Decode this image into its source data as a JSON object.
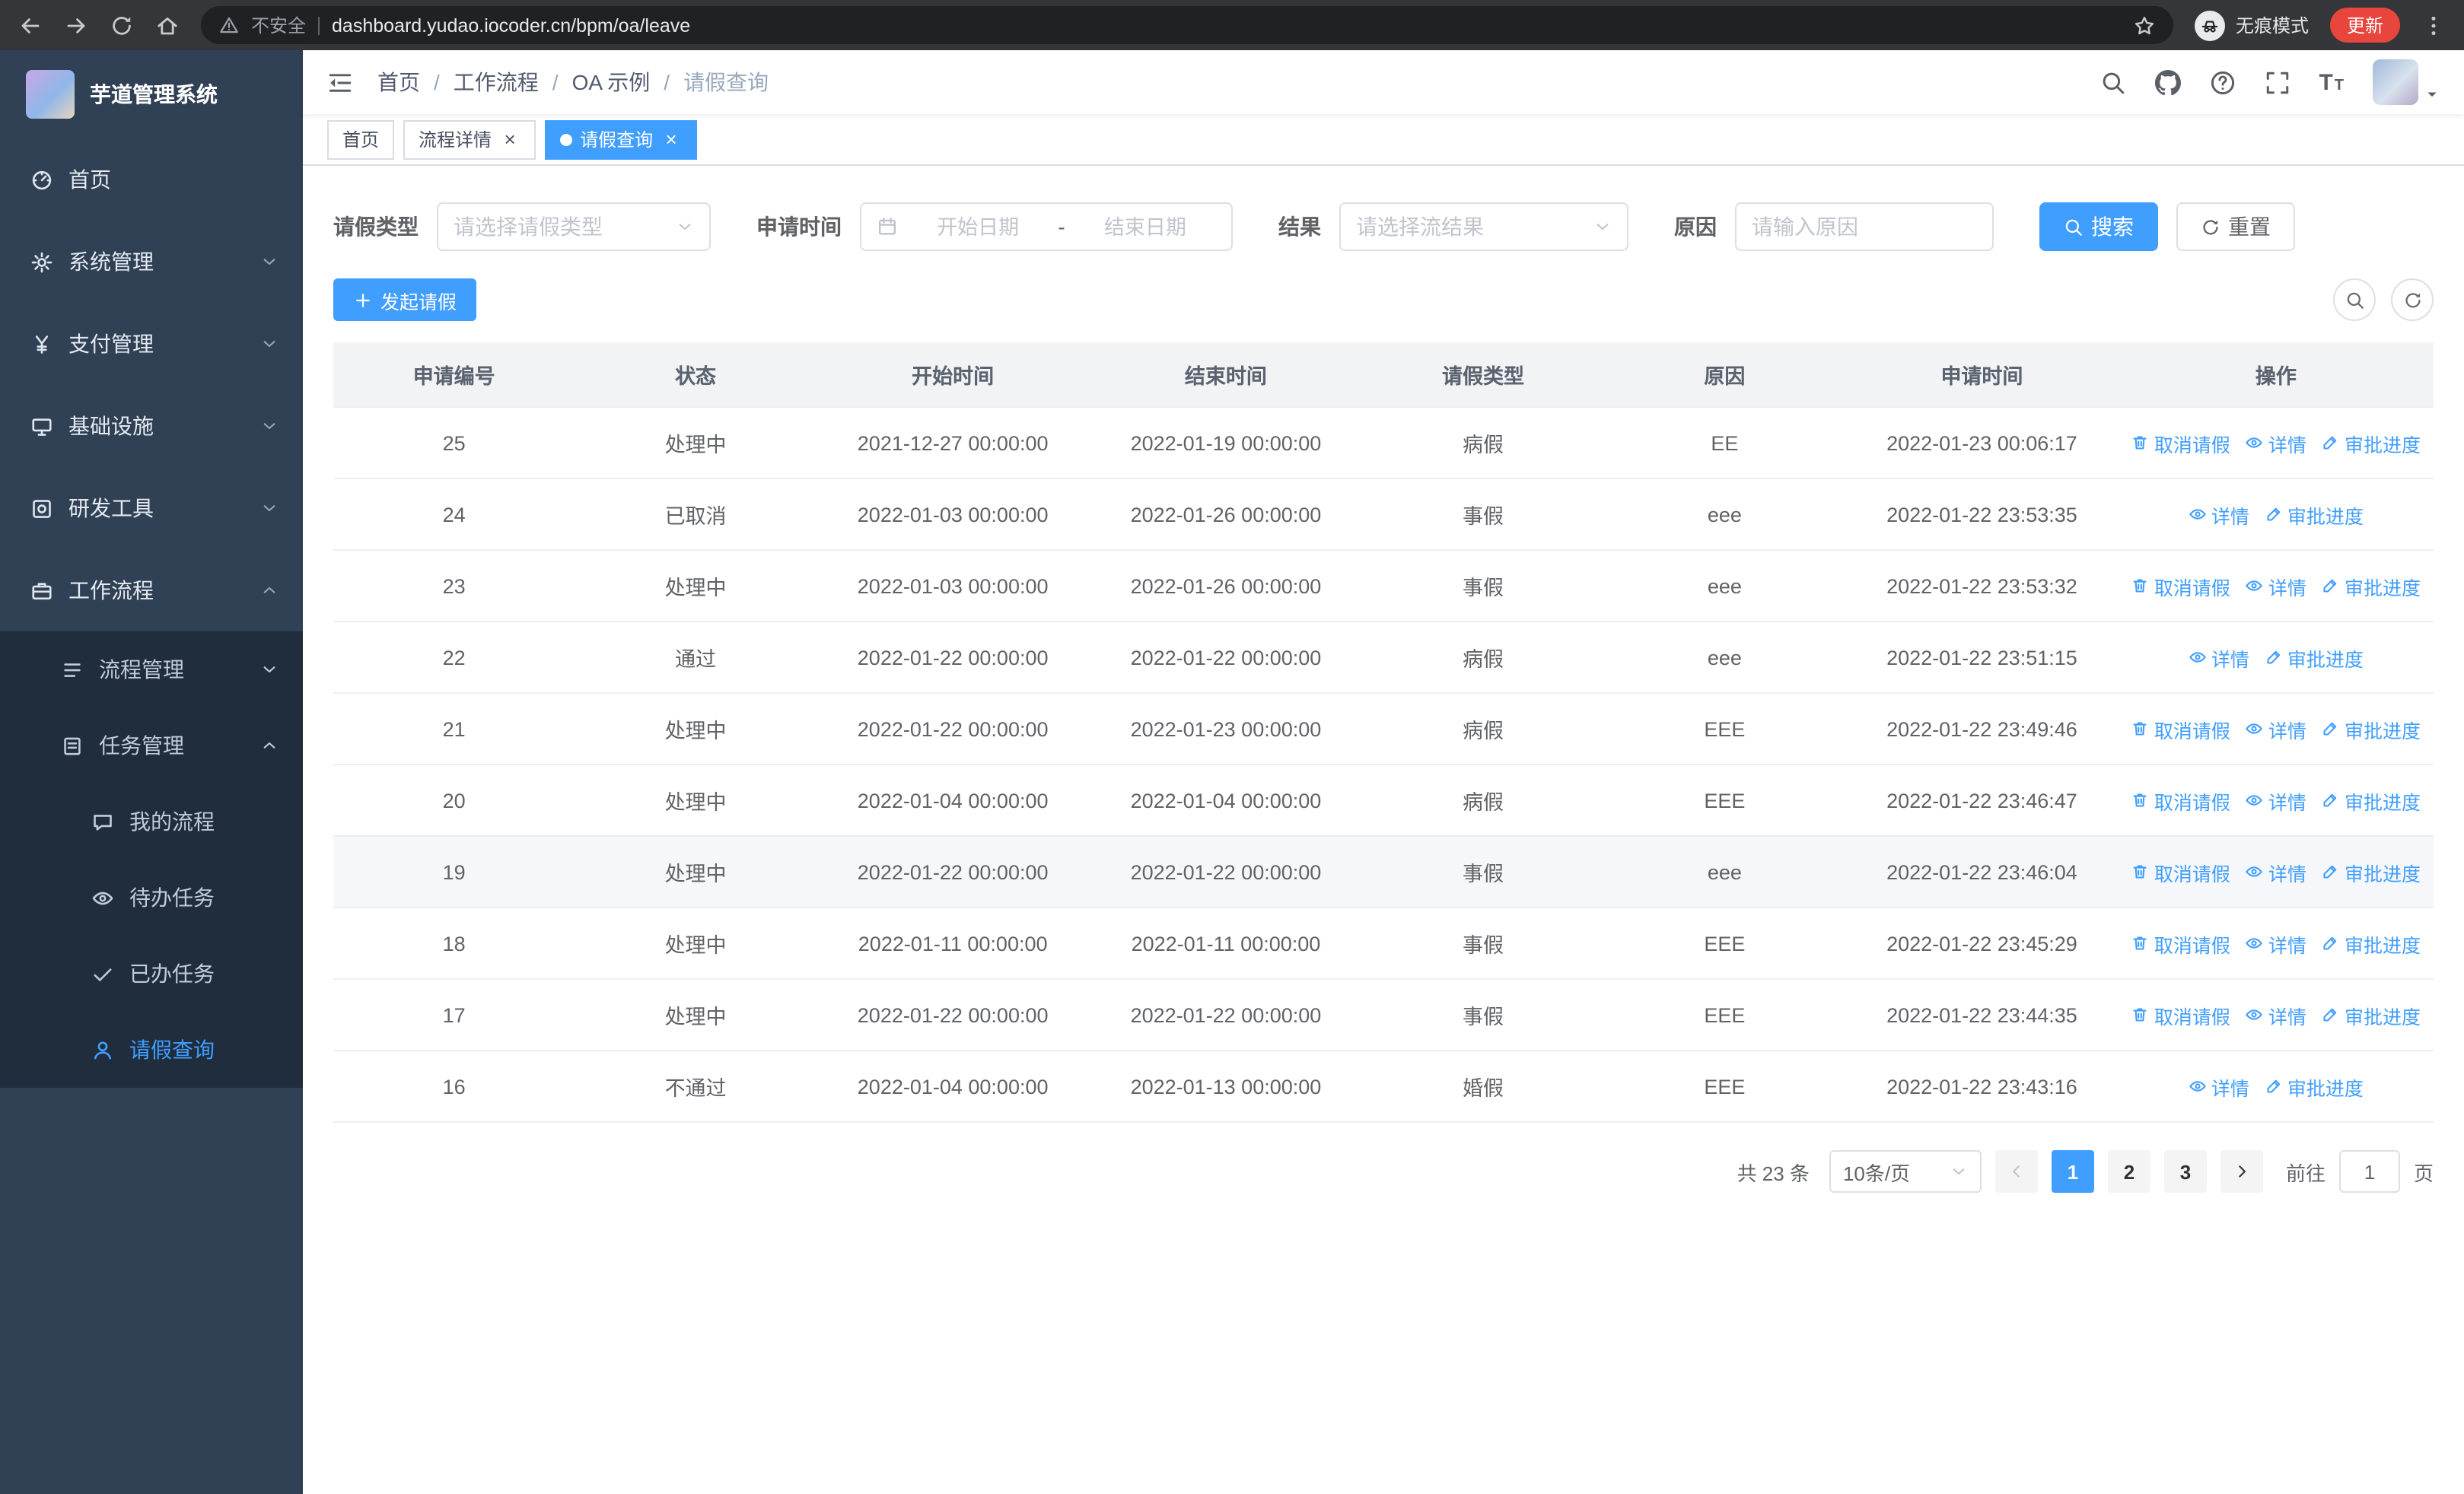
{
  "colors": {
    "accent": "#409eff",
    "sidebar_bg": "#304156",
    "submenu_bg": "#1f2d3d",
    "table_header_bg": "#f2f3f5",
    "update_badge_bg": "#e8453c"
  },
  "browser": {
    "security_warning": "不安全",
    "url": "dashboard.yudao.iocoder.cn/bpm/oa/leave",
    "incognito_label": "无痕模式",
    "update_label": "更新"
  },
  "sidebar": {
    "app_title": "芋道管理系统",
    "items": [
      {
        "id": "home",
        "label": "首页",
        "icon": "dashboard-icon",
        "level": 1,
        "expandable": false
      },
      {
        "id": "system",
        "label": "系统管理",
        "icon": "gear-icon",
        "level": 1,
        "expandable": true,
        "expanded": false
      },
      {
        "id": "payment",
        "label": "支付管理",
        "icon": "yen-icon",
        "level": 1,
        "expandable": true,
        "expanded": false
      },
      {
        "id": "infra",
        "label": "基础设施",
        "icon": "infrastructure-icon",
        "level": 1,
        "expandable": true,
        "expanded": false
      },
      {
        "id": "devtools",
        "label": "研发工具",
        "icon": "tools-icon",
        "level": 1,
        "expandable": true,
        "expanded": false
      },
      {
        "id": "workflow",
        "label": "工作流程",
        "icon": "workflow-icon",
        "level": 1,
        "expandable": true,
        "expanded": true
      },
      {
        "id": "process-mgmt",
        "label": "流程管理",
        "icon": "process-icon",
        "level": 2,
        "expandable": true,
        "expanded": false
      },
      {
        "id": "task-mgmt",
        "label": "任务管理",
        "icon": "task-icon",
        "level": 2,
        "expandable": true,
        "expanded": true
      },
      {
        "id": "my-process",
        "label": "我的流程",
        "icon": "chat-icon",
        "level": 3,
        "expandable": false
      },
      {
        "id": "todo-tasks",
        "label": "待办任务",
        "icon": "eye-icon",
        "level": 3,
        "expandable": false
      },
      {
        "id": "done-tasks",
        "label": "已办任务",
        "icon": "done-tasks-icon",
        "level": 3,
        "expandable": false
      },
      {
        "id": "leave-query",
        "label": "请假查询",
        "icon": "person-icon",
        "level": 3,
        "expandable": false,
        "active": true
      }
    ]
  },
  "breadcrumb": [
    "首页",
    "工作流程",
    "OA 示例",
    "请假查询"
  ],
  "tabs": [
    {
      "id": "home",
      "label": "首页",
      "closable": false,
      "active": false
    },
    {
      "id": "process-detail",
      "label": "流程详情",
      "closable": true,
      "active": false
    },
    {
      "id": "leave-query",
      "label": "请假查询",
      "closable": true,
      "active": true
    }
  ],
  "filters": {
    "leave_type": {
      "label": "请假类型",
      "placeholder": "请选择请假类型"
    },
    "apply_time": {
      "label": "申请时间",
      "start_placeholder": "开始日期",
      "separator": "-",
      "end_placeholder": "结束日期"
    },
    "result": {
      "label": "结果",
      "placeholder": "请选择流结果"
    },
    "reason": {
      "label": "原因",
      "placeholder": "请输入原因"
    },
    "search_label": "搜索",
    "reset_label": "重置"
  },
  "toolbar": {
    "create_label": "发起请假"
  },
  "table": {
    "columns": [
      "申请编号",
      "状态",
      "开始时间",
      "结束时间",
      "请假类型",
      "原因",
      "申请时间",
      "操作"
    ],
    "action_defs": {
      "cancel": {
        "label": "取消请假",
        "icon": "trash-icon"
      },
      "detail": {
        "label": "详情",
        "icon": "eye-icon"
      },
      "progress": {
        "label": "审批进度",
        "icon": "edit-icon"
      }
    },
    "rows": [
      {
        "id": "25",
        "status": "处理中",
        "start": "2021-12-27 00:00:00",
        "end": "2022-01-19 00:00:00",
        "type": "病假",
        "reason": "EE",
        "applied": "2022-01-23 00:06:17",
        "actions": [
          "cancel",
          "detail",
          "progress"
        ]
      },
      {
        "id": "24",
        "status": "已取消",
        "start": "2022-01-03 00:00:00",
        "end": "2022-01-26 00:00:00",
        "type": "事假",
        "reason": "eee",
        "applied": "2022-01-22 23:53:35",
        "actions": [
          "detail",
          "progress"
        ]
      },
      {
        "id": "23",
        "status": "处理中",
        "start": "2022-01-03 00:00:00",
        "end": "2022-01-26 00:00:00",
        "type": "事假",
        "reason": "eee",
        "applied": "2022-01-22 23:53:32",
        "actions": [
          "cancel",
          "detail",
          "progress"
        ]
      },
      {
        "id": "22",
        "status": "通过",
        "start": "2022-01-22 00:00:00",
        "end": "2022-01-22 00:00:00",
        "type": "病假",
        "reason": "eee",
        "applied": "2022-01-22 23:51:15",
        "actions": [
          "detail",
          "progress"
        ]
      },
      {
        "id": "21",
        "status": "处理中",
        "start": "2022-01-22 00:00:00",
        "end": "2022-01-23 00:00:00",
        "type": "病假",
        "reason": "EEE",
        "applied": "2022-01-22 23:49:46",
        "actions": [
          "cancel",
          "detail",
          "progress"
        ]
      },
      {
        "id": "20",
        "status": "处理中",
        "start": "2022-01-04 00:00:00",
        "end": "2022-01-04 00:00:00",
        "type": "病假",
        "reason": "EEE",
        "applied": "2022-01-22 23:46:47",
        "actions": [
          "cancel",
          "detail",
          "progress"
        ]
      },
      {
        "id": "19",
        "status": "处理中",
        "start": "2022-01-22 00:00:00",
        "end": "2022-01-22 00:00:00",
        "type": "事假",
        "reason": "eee",
        "applied": "2022-01-22 23:46:04",
        "actions": [
          "cancel",
          "detail",
          "progress"
        ],
        "highlighted": true
      },
      {
        "id": "18",
        "status": "处理中",
        "start": "2022-01-11 00:00:00",
        "end": "2022-01-11 00:00:00",
        "type": "事假",
        "reason": "EEE",
        "applied": "2022-01-22 23:45:29",
        "actions": [
          "cancel",
          "detail",
          "progress"
        ]
      },
      {
        "id": "17",
        "status": "处理中",
        "start": "2022-01-22 00:00:00",
        "end": "2022-01-22 00:00:00",
        "type": "事假",
        "reason": "EEE",
        "applied": "2022-01-22 23:44:35",
        "actions": [
          "cancel",
          "detail",
          "progress"
        ]
      },
      {
        "id": "16",
        "status": "不通过",
        "start": "2022-01-04 00:00:00",
        "end": "2022-01-13 00:00:00",
        "type": "婚假",
        "reason": "EEE",
        "applied": "2022-01-22 23:43:16",
        "actions": [
          "detail",
          "progress"
        ]
      }
    ]
  },
  "pagination": {
    "total_text": "共 23 条",
    "page_size": "10条/页",
    "pages": [
      "1",
      "2",
      "3"
    ],
    "active_page": "1",
    "goto_label": "前往",
    "goto_value": "1",
    "goto_suffix": "页"
  }
}
